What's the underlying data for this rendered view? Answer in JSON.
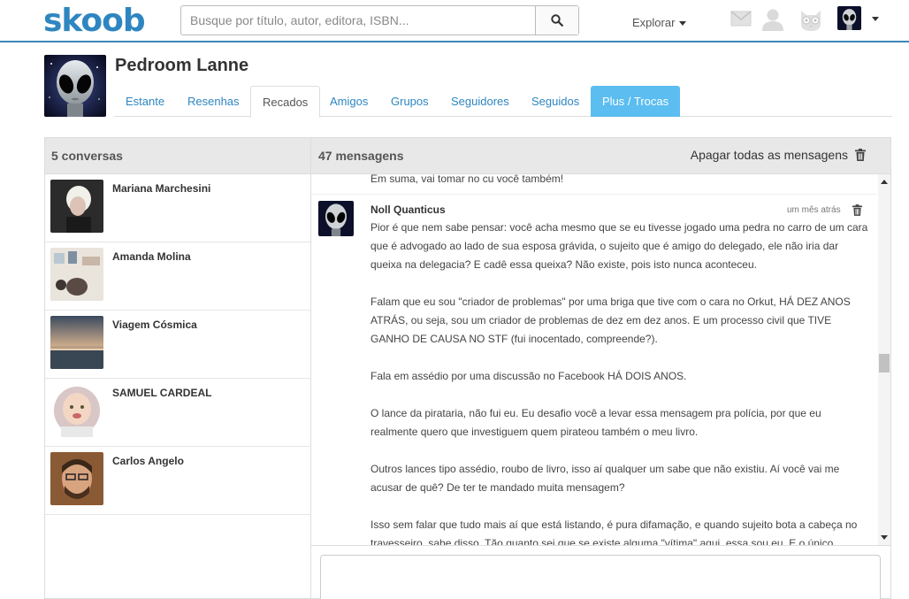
{
  "app": {
    "logo": "skoob",
    "search_placeholder": "Busque por título, autor, editora, ISBN...",
    "explore_label": "Explorar"
  },
  "profile": {
    "name": "Pedroom Lanne",
    "tabs": [
      {
        "label": "Estante"
      },
      {
        "label": "Resenhas"
      },
      {
        "label": "Recados"
      },
      {
        "label": "Amigos"
      },
      {
        "label": "Grupos"
      },
      {
        "label": "Seguidores"
      },
      {
        "label": "Seguidos"
      },
      {
        "label": "Plus / Trocas"
      }
    ]
  },
  "conversations": {
    "header": "5 conversas",
    "items": [
      {
        "name": "Mariana Marchesini"
      },
      {
        "name": "Amanda Molina"
      },
      {
        "name": "Viagem Cósmica"
      },
      {
        "name": "SAMUEL CARDEAL"
      },
      {
        "name": "Carlos Angelo"
      }
    ]
  },
  "messages": {
    "header": "47 mensagens",
    "delete_all_label": "Apagar todas as mensagens",
    "previous_tail": "Em suma, vai tomar no cu você também!",
    "current": {
      "author": "Noll Quanticus",
      "time": "um mês atrás",
      "paragraphs": [
        "Pior é que nem sabe pensar: você acha mesmo que se eu tivesse jogado uma pedra no carro de um cara que é advogado ao lado de sua esposa grávida, o sujeito que é amigo do delegado, ele não iria dar queixa na delegacia? E cadê essa queixa? Não existe, pois isto nunca aconteceu.",
        "Falam que eu sou \"criador de problemas\" por uma briga que tive com o cara no Orkut, HÁ DEZ ANOS ATRÁS, ou seja, sou um criador de problemas de dez em dez anos. E um processo civil que TIVE GANHO DE CAUSA NO STF (fui inocentado, compreende?).",
        "Fala em assédio por uma discussão no Facebook HÁ DOIS ANOS.",
        "O lance da pirataria, não fui eu. Eu desafio você a levar essa mensagem pra polícia, por que eu realmente quero que investiguem quem pirateou também o meu livro.",
        "Outros lances tipo assédio, roubo de livro, isso aí qualquer um sabe que não existiu. Aí você vai me acusar de quê? De ter te mandado muita mensagem?",
        "Isso sem falar que tudo mais aí que está listando, é pura difamação, e quando sujeito bota a cabeça no travesseiro, sabe disso. Tão quanto sei que se existe alguma \"vítima\" aqui, essa sou eu. E o único"
      ]
    }
  },
  "colors": {
    "brand": "#2e86c1",
    "plus_tab": "#5bbdf0",
    "panel_header": "#e8e8e8"
  }
}
